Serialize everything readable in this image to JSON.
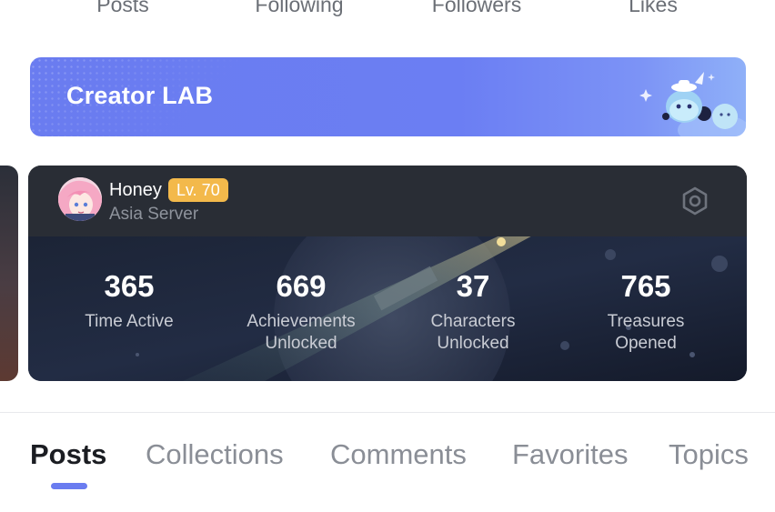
{
  "profile_stats": {
    "posts_label": "Posts",
    "following_label": "Following",
    "followers_label": "Followers",
    "likes_label": "Likes"
  },
  "creator_lab": {
    "title": "Creator LAB"
  },
  "game_card": {
    "username": "Honey",
    "level": "Lv. 70",
    "server": "Asia Server",
    "stats": [
      {
        "value": "365",
        "label_line1": "Time Active",
        "label_line2": ""
      },
      {
        "value": "669",
        "label_line1": "Achievements",
        "label_line2": "Unlocked"
      },
      {
        "value": "37",
        "label_line1": "Characters",
        "label_line2": "Unlocked"
      },
      {
        "value": "765",
        "label_line1": "Treasures",
        "label_line2": "Opened"
      }
    ]
  },
  "tabs": [
    {
      "label": "Posts",
      "active": true
    },
    {
      "label": "Collections",
      "active": false
    },
    {
      "label": "Comments",
      "active": false
    },
    {
      "label": "Favorites",
      "active": false
    },
    {
      "label": "Topics",
      "active": false
    }
  ],
  "colors": {
    "accent": "#6a7cf0",
    "level_badge": "#f3b94b",
    "card_bg": "#272b33"
  }
}
